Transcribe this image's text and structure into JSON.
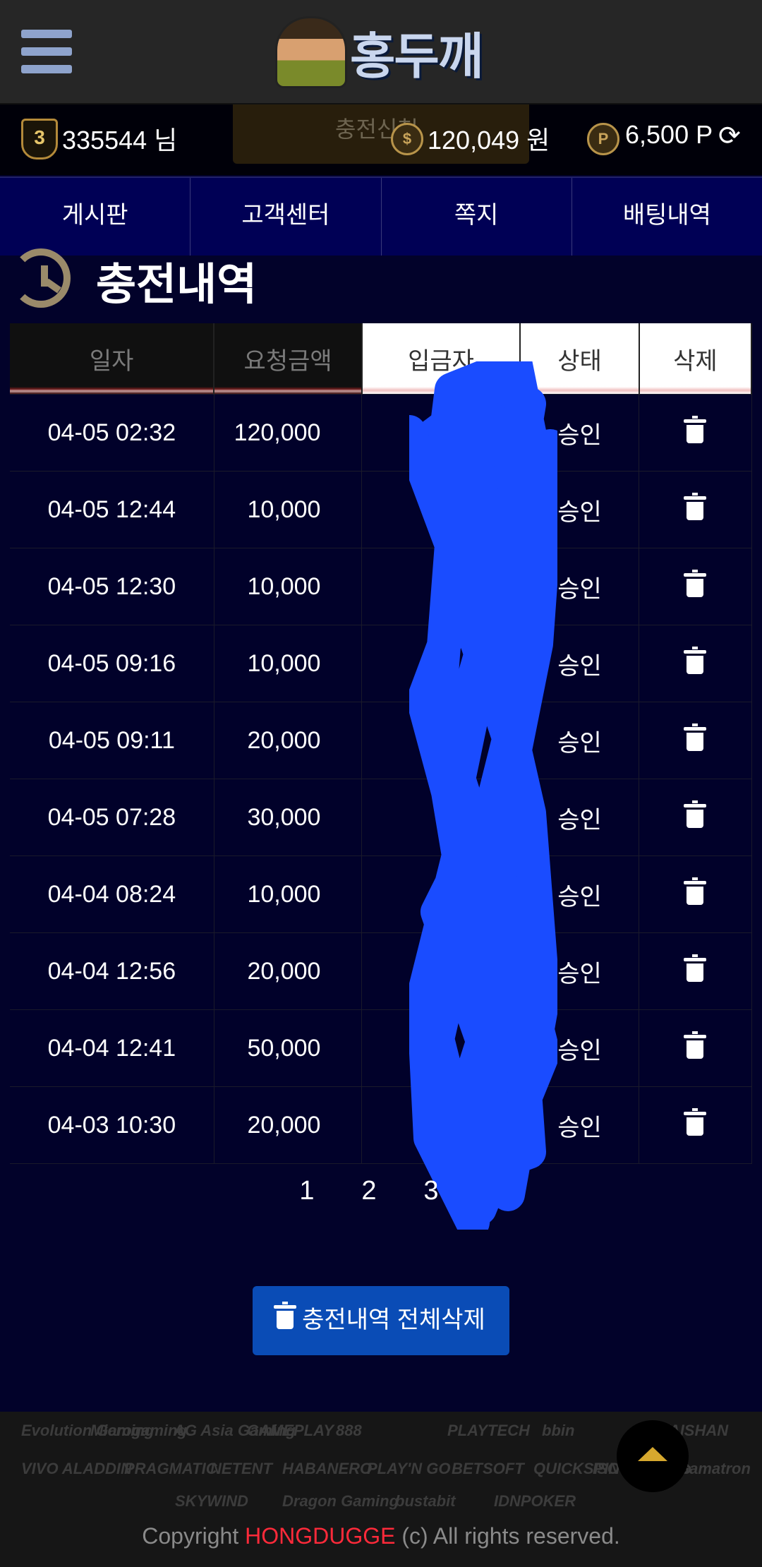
{
  "header": {
    "logo_text": "홍두깨"
  },
  "user": {
    "level": "3",
    "name": "335544 님",
    "charge_ghost": "충전신청",
    "money": "120,049 원",
    "points": "6,500 P"
  },
  "nav": [
    "게시판",
    "고객센터",
    "쪽지",
    "배팅내역"
  ],
  "section": {
    "title": "충전내역"
  },
  "table": {
    "headers": [
      "일자",
      "요청금액",
      "입금자",
      "상태",
      "삭제"
    ],
    "rows": [
      {
        "date": "04-05 02:32",
        "amount": "120,000",
        "status": "승인"
      },
      {
        "date": "04-05 12:44",
        "amount": "10,000",
        "status": "승인"
      },
      {
        "date": "04-05 12:30",
        "amount": "10,000",
        "status": "승인"
      },
      {
        "date": "04-05 09:16",
        "amount": "10,000",
        "status": "승인"
      },
      {
        "date": "04-05 09:11",
        "amount": "20,000",
        "status": "승인"
      },
      {
        "date": "04-05 07:28",
        "amount": "30,000",
        "status": "승인"
      },
      {
        "date": "04-04 08:24",
        "amount": "10,000",
        "status": "승인"
      },
      {
        "date": "04-04 12:56",
        "amount": "20,000",
        "status": "승인"
      },
      {
        "date": "04-04 12:41",
        "amount": "50,000",
        "status": "승인"
      },
      {
        "date": "04-03 10:30",
        "amount": "20,000",
        "status": "승인"
      }
    ]
  },
  "pagination": [
    "1",
    "2",
    "3"
  ],
  "delete_all_label": "충전내역 전체삭제",
  "footer": {
    "providers": [
      "Evolution Gaming",
      "Microgaming",
      "AG Asia Gaming",
      "GAMEPLAY",
      "888",
      "PLAYTECH",
      "bbin",
      "TAISHAN",
      "VIVO ALADDIN",
      "PRAGMATIC",
      "NETENT",
      "HABANERO",
      "PLAY'N GO",
      "BETSOFT",
      "QUICKSPIN",
      "booongo",
      "ISO",
      "Gamatron",
      "SKYWIND",
      "Dragon Gaming",
      "bustabit",
      "IDNPOKER"
    ],
    "copyright_pre": "Copyright ",
    "copyright_brand": "HONGDUGGE",
    "copyright_post": " (c) All rights reserved."
  },
  "colors": {
    "nav_bg": "#000055",
    "accent_blue": "#0a4cb6",
    "brand_red": "#ff2a3a",
    "scribble": "#1a4cff"
  },
  "icons": {
    "menu": "hamburger-icon",
    "level": "level-badge-icon",
    "coin": "coin-icon",
    "point": "point-icon",
    "refresh": "refresh-icon",
    "history": "history-icon",
    "delete": "trash-icon",
    "top": "scroll-top-icon"
  }
}
